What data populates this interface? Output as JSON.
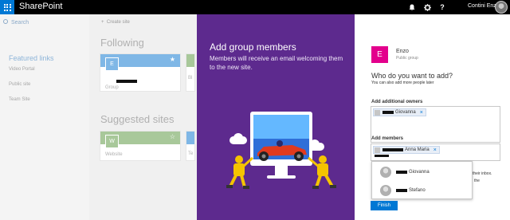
{
  "topbar": {
    "brand": "SharePoint",
    "user_name": "Contini Enzo",
    "icons": [
      "waffle-icon",
      "bell-icon",
      "gear-icon",
      "help-icon"
    ],
    "help_glyph": "?",
    "accent": "#0078d4"
  },
  "background_page": {
    "search_placeholder": "Search",
    "create_site": "Create site",
    "featured_links_title": "Featured links",
    "featured_links": [
      "Video Portal",
      "Public site",
      "Team Site"
    ],
    "following_title": "Following",
    "following_card": {
      "initial": "E",
      "subtitle": "Group",
      "band_color": "#7fb7e6"
    },
    "following_peek_label": "Bl",
    "suggested_title": "Suggested sites",
    "suggested_card": {
      "initial": "W",
      "subtitle": "Website",
      "band_color": "#a8c89a"
    },
    "suggested_peek_label": "Te"
  },
  "purple_panel": {
    "title": "Add group members",
    "description": "Members will receive an email welcoming them to the new site.",
    "color": "#5d2a8e"
  },
  "dialog": {
    "group_initial": "E",
    "group_name": "Enzo",
    "group_type": "Public group",
    "question": "Who do you want to add?",
    "question_sub": "You can also add more people later",
    "owners_label": "Add additional owners",
    "owners": [
      {
        "name": "Giovanna"
      }
    ],
    "members_label": "Add members",
    "members": [
      {
        "name": "Anna Maria"
      }
    ],
    "suggestions": [
      {
        "name": "Giovanna"
      },
      {
        "name": "Stefano"
      }
    ],
    "behind_text_1": "their inbox.",
    "behind_text_2": "the",
    "finish_label": "Finish",
    "remove_glyph": "×"
  }
}
